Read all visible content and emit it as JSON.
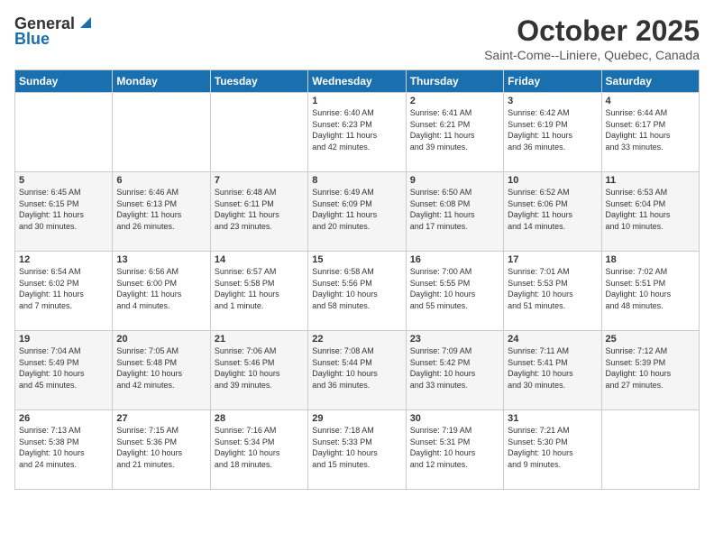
{
  "header": {
    "logo_general": "General",
    "logo_blue": "Blue",
    "month": "October 2025",
    "location": "Saint-Come--Liniere, Quebec, Canada"
  },
  "days_of_week": [
    "Sunday",
    "Monday",
    "Tuesday",
    "Wednesday",
    "Thursday",
    "Friday",
    "Saturday"
  ],
  "weeks": [
    [
      {
        "day": "",
        "info": ""
      },
      {
        "day": "",
        "info": ""
      },
      {
        "day": "",
        "info": ""
      },
      {
        "day": "1",
        "info": "Sunrise: 6:40 AM\nSunset: 6:23 PM\nDaylight: 11 hours\nand 42 minutes."
      },
      {
        "day": "2",
        "info": "Sunrise: 6:41 AM\nSunset: 6:21 PM\nDaylight: 11 hours\nand 39 minutes."
      },
      {
        "day": "3",
        "info": "Sunrise: 6:42 AM\nSunset: 6:19 PM\nDaylight: 11 hours\nand 36 minutes."
      },
      {
        "day": "4",
        "info": "Sunrise: 6:44 AM\nSunset: 6:17 PM\nDaylight: 11 hours\nand 33 minutes."
      }
    ],
    [
      {
        "day": "5",
        "info": "Sunrise: 6:45 AM\nSunset: 6:15 PM\nDaylight: 11 hours\nand 30 minutes."
      },
      {
        "day": "6",
        "info": "Sunrise: 6:46 AM\nSunset: 6:13 PM\nDaylight: 11 hours\nand 26 minutes."
      },
      {
        "day": "7",
        "info": "Sunrise: 6:48 AM\nSunset: 6:11 PM\nDaylight: 11 hours\nand 23 minutes."
      },
      {
        "day": "8",
        "info": "Sunrise: 6:49 AM\nSunset: 6:09 PM\nDaylight: 11 hours\nand 20 minutes."
      },
      {
        "day": "9",
        "info": "Sunrise: 6:50 AM\nSunset: 6:08 PM\nDaylight: 11 hours\nand 17 minutes."
      },
      {
        "day": "10",
        "info": "Sunrise: 6:52 AM\nSunset: 6:06 PM\nDaylight: 11 hours\nand 14 minutes."
      },
      {
        "day": "11",
        "info": "Sunrise: 6:53 AM\nSunset: 6:04 PM\nDaylight: 11 hours\nand 10 minutes."
      }
    ],
    [
      {
        "day": "12",
        "info": "Sunrise: 6:54 AM\nSunset: 6:02 PM\nDaylight: 11 hours\nand 7 minutes."
      },
      {
        "day": "13",
        "info": "Sunrise: 6:56 AM\nSunset: 6:00 PM\nDaylight: 11 hours\nand 4 minutes."
      },
      {
        "day": "14",
        "info": "Sunrise: 6:57 AM\nSunset: 5:58 PM\nDaylight: 11 hours\nand 1 minute."
      },
      {
        "day": "15",
        "info": "Sunrise: 6:58 AM\nSunset: 5:56 PM\nDaylight: 10 hours\nand 58 minutes."
      },
      {
        "day": "16",
        "info": "Sunrise: 7:00 AM\nSunset: 5:55 PM\nDaylight: 10 hours\nand 55 minutes."
      },
      {
        "day": "17",
        "info": "Sunrise: 7:01 AM\nSunset: 5:53 PM\nDaylight: 10 hours\nand 51 minutes."
      },
      {
        "day": "18",
        "info": "Sunrise: 7:02 AM\nSunset: 5:51 PM\nDaylight: 10 hours\nand 48 minutes."
      }
    ],
    [
      {
        "day": "19",
        "info": "Sunrise: 7:04 AM\nSunset: 5:49 PM\nDaylight: 10 hours\nand 45 minutes."
      },
      {
        "day": "20",
        "info": "Sunrise: 7:05 AM\nSunset: 5:48 PM\nDaylight: 10 hours\nand 42 minutes."
      },
      {
        "day": "21",
        "info": "Sunrise: 7:06 AM\nSunset: 5:46 PM\nDaylight: 10 hours\nand 39 minutes."
      },
      {
        "day": "22",
        "info": "Sunrise: 7:08 AM\nSunset: 5:44 PM\nDaylight: 10 hours\nand 36 minutes."
      },
      {
        "day": "23",
        "info": "Sunrise: 7:09 AM\nSunset: 5:42 PM\nDaylight: 10 hours\nand 33 minutes."
      },
      {
        "day": "24",
        "info": "Sunrise: 7:11 AM\nSunset: 5:41 PM\nDaylight: 10 hours\nand 30 minutes."
      },
      {
        "day": "25",
        "info": "Sunrise: 7:12 AM\nSunset: 5:39 PM\nDaylight: 10 hours\nand 27 minutes."
      }
    ],
    [
      {
        "day": "26",
        "info": "Sunrise: 7:13 AM\nSunset: 5:38 PM\nDaylight: 10 hours\nand 24 minutes."
      },
      {
        "day": "27",
        "info": "Sunrise: 7:15 AM\nSunset: 5:36 PM\nDaylight: 10 hours\nand 21 minutes."
      },
      {
        "day": "28",
        "info": "Sunrise: 7:16 AM\nSunset: 5:34 PM\nDaylight: 10 hours\nand 18 minutes."
      },
      {
        "day": "29",
        "info": "Sunrise: 7:18 AM\nSunset: 5:33 PM\nDaylight: 10 hours\nand 15 minutes."
      },
      {
        "day": "30",
        "info": "Sunrise: 7:19 AM\nSunset: 5:31 PM\nDaylight: 10 hours\nand 12 minutes."
      },
      {
        "day": "31",
        "info": "Sunrise: 7:21 AM\nSunset: 5:30 PM\nDaylight: 10 hours\nand 9 minutes."
      },
      {
        "day": "",
        "info": ""
      }
    ]
  ]
}
